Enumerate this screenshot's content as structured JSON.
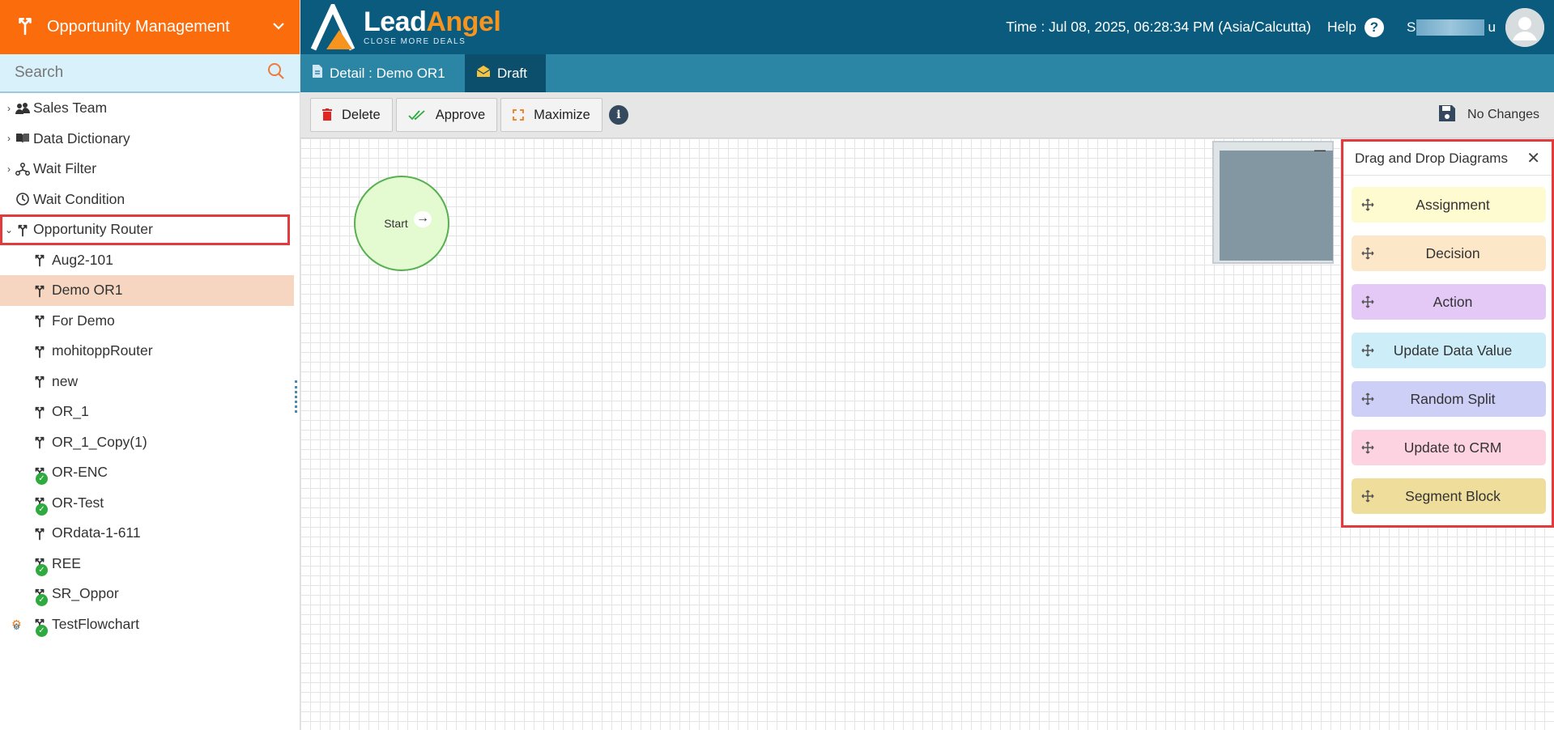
{
  "module": {
    "title": "Opportunity Management"
  },
  "search": {
    "placeholder": "Search"
  },
  "tree": {
    "groups": [
      {
        "label": "Sales Team"
      },
      {
        "label": "Data Dictionary"
      },
      {
        "label": "Wait Filter"
      },
      {
        "label": "Wait Condition"
      },
      {
        "label": "Opportunity Router"
      }
    ],
    "children": [
      {
        "label": "Aug2-101"
      },
      {
        "label": "Demo OR1"
      },
      {
        "label": "For Demo"
      },
      {
        "label": "mohitoppRouter"
      },
      {
        "label": "new"
      },
      {
        "label": "OR_1"
      },
      {
        "label": "OR_1_Copy(1)"
      },
      {
        "label": "OR-ENC"
      },
      {
        "label": "OR-Test"
      },
      {
        "label": "ORdata-1-611"
      },
      {
        "label": "REE"
      },
      {
        "label": "SR_Oppor"
      },
      {
        "label": "TestFlowchart"
      }
    ]
  },
  "header": {
    "brand_lead": "Lead",
    "brand_angel": "Angel",
    "tagline": "CLOSE MORE DEALS",
    "time": "Time : Jul 08, 2025, 06:28:34 PM (Asia/Calcutta)",
    "help": "Help",
    "help_symbol": "?",
    "username_start": "S",
    "username_end": "u"
  },
  "tabs": {
    "detail": "Detail : Demo OR1",
    "draft": "Draft"
  },
  "toolbar": {
    "delete": "Delete",
    "approve": "Approve",
    "maximize": "Maximize",
    "info": "i",
    "status": "No Changes"
  },
  "canvas": {
    "start_label": "Start",
    "start_arrow": "→",
    "minimize": "—"
  },
  "dnd": {
    "title": "Drag and Drop Diagrams",
    "close": "✕",
    "items": [
      {
        "label": "Assignment",
        "color": "#fdfbcf"
      },
      {
        "label": "Decision",
        "color": "#fde7c9"
      },
      {
        "label": "Action",
        "color": "#e4c8f5"
      },
      {
        "label": "Update Data Value",
        "color": "#cdeef9"
      },
      {
        "label": "Random Split",
        "color": "#cdcff7"
      },
      {
        "label": "Update to CRM",
        "color": "#fdd3e2"
      },
      {
        "label": "Segment Block",
        "color": "#eedd9b"
      }
    ]
  },
  "colors": {
    "module_bar": "#fb6c0c",
    "header": "#0a5b7e",
    "tabbar": "#2b86a6",
    "selected_row": "#f6d6c0",
    "highlight_border": "#e23b3b"
  }
}
